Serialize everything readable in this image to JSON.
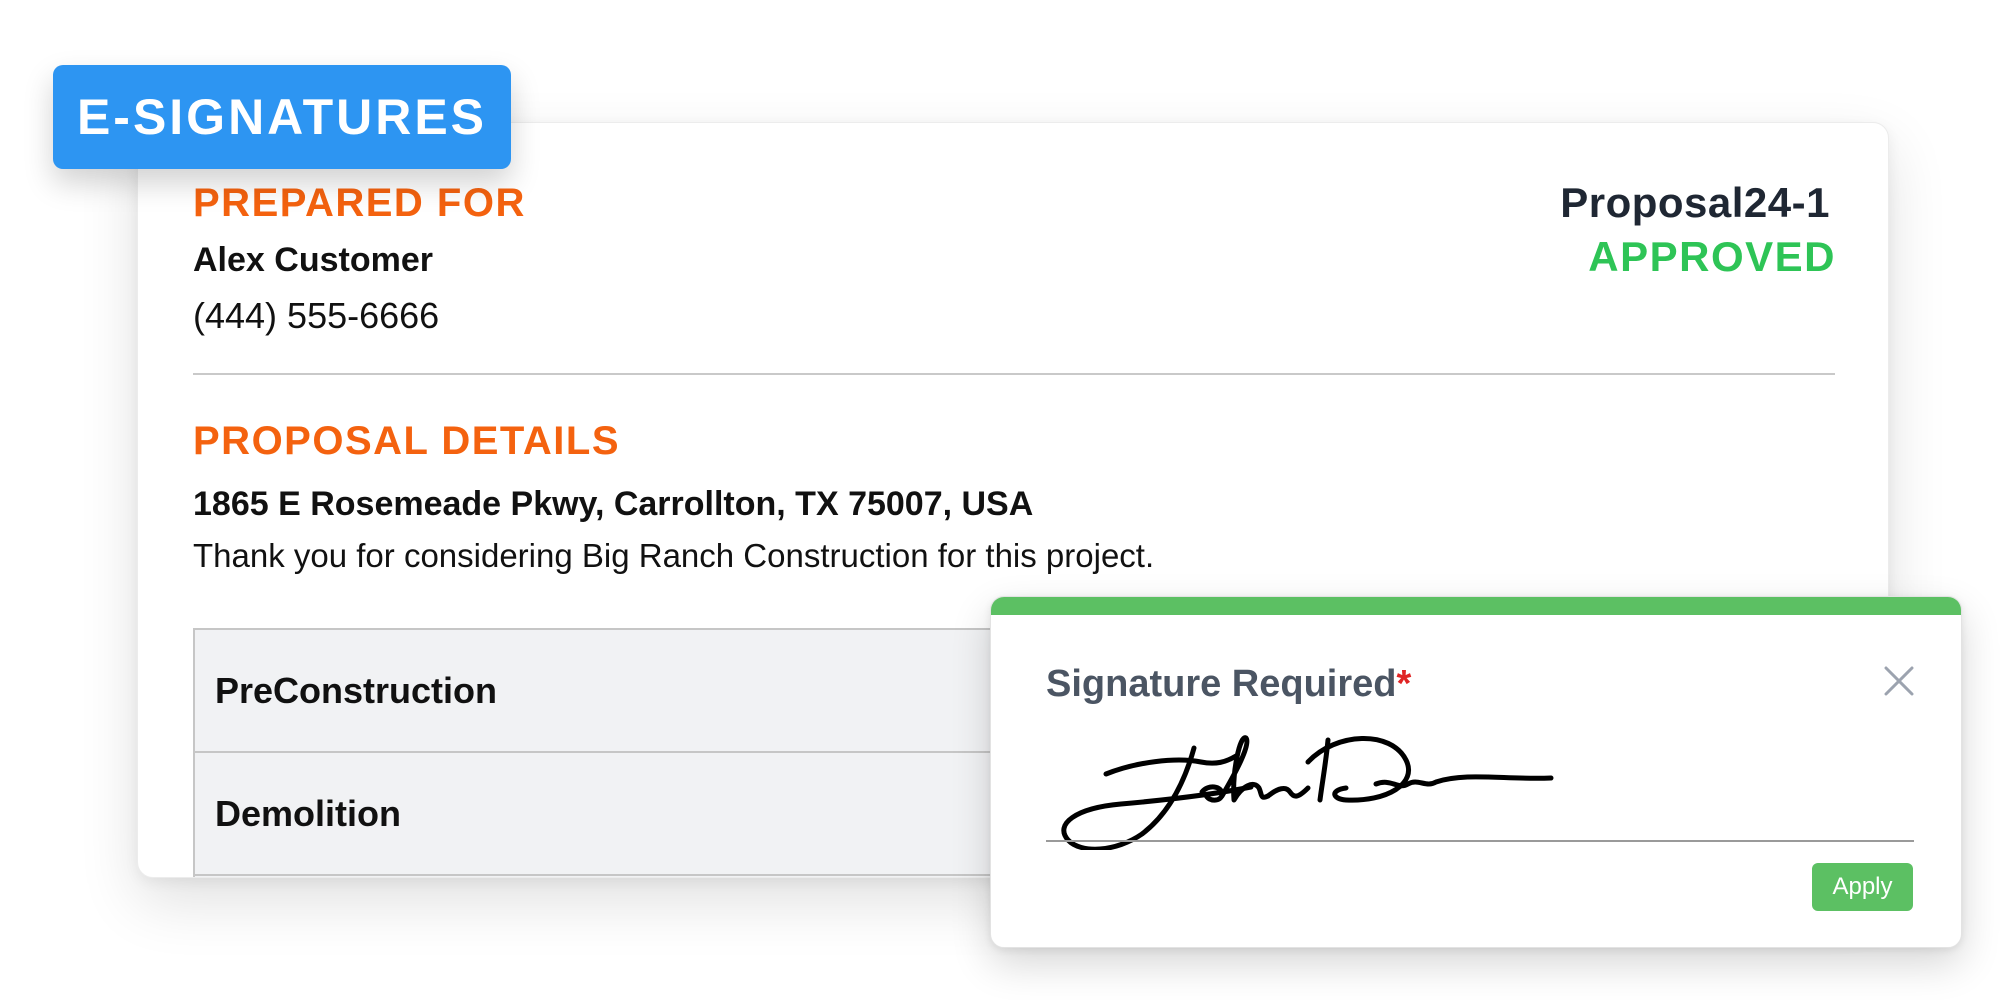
{
  "badge": {
    "label": "E-SIGNATURES"
  },
  "document": {
    "prepared_for_heading": "PREPARED FOR",
    "customer_name": "Alex Customer",
    "customer_phone": "(444) 555-6666",
    "proposal_id": "Proposal24-1",
    "proposal_status": "APPROVED",
    "details_heading": "PROPOSAL DETAILS",
    "address": "1865 E Rosemeade Pkwy, Carrollton, TX 75007, USA",
    "intro": "Thank you for considering Big Ranch Construction for this project.",
    "sections": [
      {
        "label": "PreConstruction"
      },
      {
        "label": "Demolition"
      }
    ]
  },
  "signature_modal": {
    "title": "Signature Required",
    "required_marker": "*",
    "close_icon": "close-icon",
    "apply_label": "Apply"
  },
  "colors": {
    "accent_blue": "#2d95f2",
    "heading_orange": "#f4620f",
    "approved_green": "#2ec456",
    "modal_green": "#5cc063",
    "required_red": "#e02424"
  }
}
